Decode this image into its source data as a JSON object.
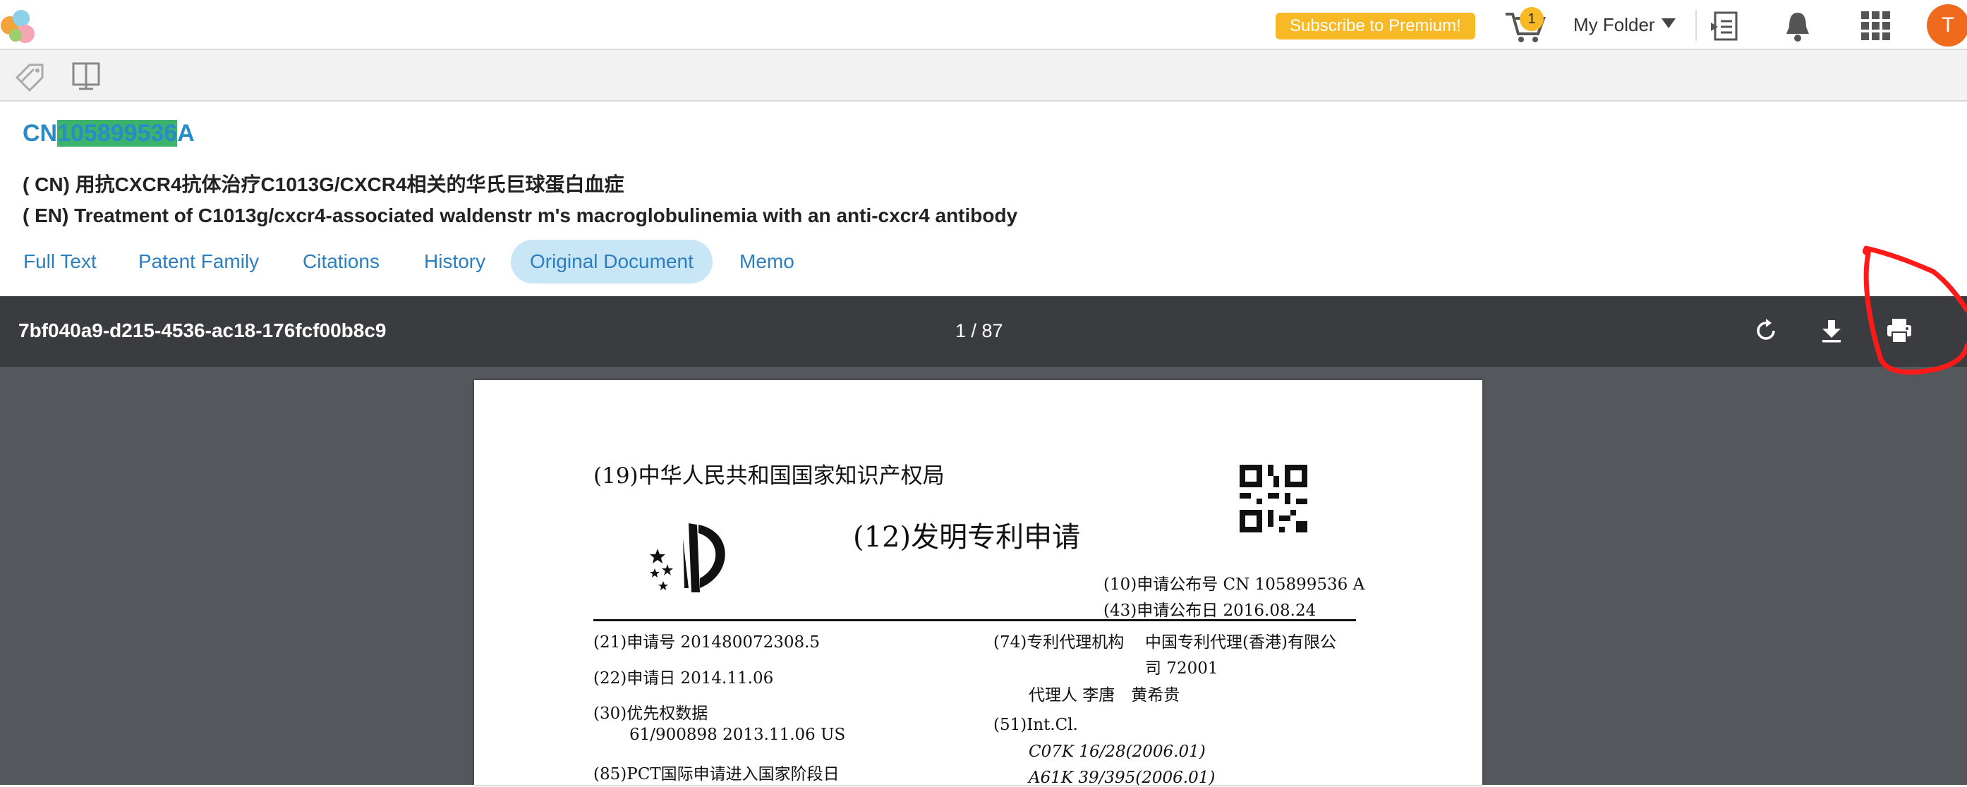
{
  "topbar": {
    "premium_label": "Subscribe to Premium!",
    "cart_count": "1",
    "folder_label": "My Folder",
    "avatar_initial": "T"
  },
  "patent": {
    "pub_prefix": "CN",
    "pub_number": "105899536",
    "pub_suffix": "A",
    "title_cn": "( CN) 用抗CXCR4抗体治疗C1013G/CXCR4相关的华氏巨球蛋白血症",
    "title_en": "( EN) Treatment of C1013g/cxcr4-associated waldenstr m's macroglobulinemia with an anti-cxcr4 antibody"
  },
  "tabs": [
    {
      "label": "Full Text"
    },
    {
      "label": "Patent Family"
    },
    {
      "label": "Citations"
    },
    {
      "label": "History"
    },
    {
      "label": "Original Document"
    },
    {
      "label": "Memo"
    }
  ],
  "viewer": {
    "doc_id": "7bf040a9-d215-4536-ac18-176fcf00b8c9",
    "page_indicator": "1 / 87"
  },
  "document": {
    "office": "(19)中华人民共和国国家知识产权局",
    "doc_type": "(12)发明专利申请",
    "f10": "(10)申请公布号 CN 105899536 A",
    "f43": "(43)申请公布日 2016.08.24",
    "f21": "(21)申请号 201480072308.5",
    "f22": "(22)申请日 2014.11.06",
    "f30": "(30)优先权数据",
    "f30_val": "61/900898 2013.11.06 US",
    "f85": "(85)PCT国际申请进入国家阶段日",
    "f74_label": "(74)专利代理机构",
    "f74_val1": "中国专利代理(香港)有限公",
    "f74_val2": "司 72001",
    "agent": "代理人 李唐　黄希贵",
    "f51": "(51)Int.Cl.",
    "ipc1": "C07K 16/28(2006.01)",
    "ipc2": "A61K 39/395(2006.01)"
  },
  "icons": {
    "logo": "app-logo",
    "tag": "tag-icon",
    "split": "split-view-icon",
    "cart": "cart-icon",
    "export": "export-icon",
    "bell": "bell-icon",
    "grid": "apps-grid-icon",
    "rotate": "rotate-icon",
    "download": "download-icon",
    "print": "print-icon"
  },
  "colors": {
    "accent": "#2a8bc6",
    "premium": "#f7b925",
    "avatar": "#f06a1d",
    "highlight": "#3bb36a",
    "annotation": "#ff0000"
  }
}
